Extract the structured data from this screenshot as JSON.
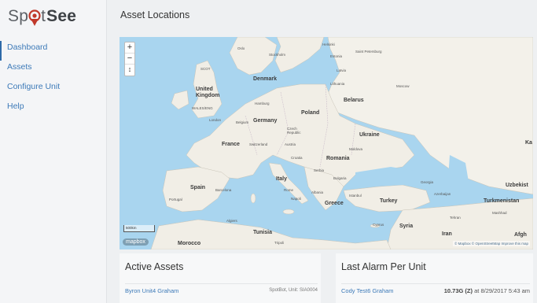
{
  "app": {
    "logo_left": "Sp",
    "logo_mid": "t",
    "logo_right": "See",
    "brand_color": "#c0392b"
  },
  "sidebar": {
    "items": [
      {
        "label": "Dashboard",
        "active": true
      },
      {
        "label": "Assets",
        "active": false
      },
      {
        "label": "Configure Unit",
        "active": false
      },
      {
        "label": "Help",
        "active": false
      }
    ]
  },
  "page": {
    "title": "Asset Locations"
  },
  "map": {
    "zoom_in": "+",
    "zoom_out": "−",
    "reset": "↕",
    "scale": "500km",
    "provider": "mapbox",
    "attribution": "© Mapbox © OpenStreetMap Improve this map",
    "labels": {
      "oslo": "Oslo",
      "stockholm": "Stockholm",
      "helsinki": "Helsinki",
      "saint_petersburg": "Saint Petersburg",
      "estonia": "Estonia",
      "latvia": "Latvia",
      "lithuania": "Lithuania",
      "moscow": "Moscow",
      "scot": "SCOT",
      "united_kingdom": "United Kingdom",
      "wales": "WALES/ENG",
      "london": "London",
      "denmark": "Denmark",
      "hamburg": "Hamburg",
      "poland": "Poland",
      "belarus": "Belarus",
      "germany": "Germany",
      "belgium": "Belgium",
      "czech": "Czech Republic",
      "ukraine": "Ukraine",
      "austria": "Austria",
      "switzerland": "Switzerland",
      "moldova": "Moldova",
      "france": "France",
      "croatia": "Croatia",
      "romania": "Romania",
      "serbia": "Serbia",
      "bulgaria": "Bulgaria",
      "italy": "Italy",
      "spain": "Spain",
      "portugal": "Portugal",
      "barcelona": "Barcelona",
      "rome": "Rome",
      "napoli": "Napoli",
      "albania": "Albania",
      "istanbul": "Istanbul",
      "greece": "Greece",
      "turkey": "Turkey",
      "georgia": "Georgia",
      "azerbaijan": "Azerbaijan",
      "uzbekistan": "Uzbekist",
      "turkmenistan": "Turkmenistan",
      "tehran": "Tehran",
      "mashhad": "Mashhad",
      "iran": "Iran",
      "syria": "Syria",
      "cyprus": "Cyprus",
      "tunisia": "Tunisia",
      "algiers": "Algiers",
      "morocco": "Morocco",
      "tripoli": "Tripoli",
      "kaz": "Ka",
      "afgh": "Afgh"
    }
  },
  "active_assets": {
    "title": "Active Assets",
    "rows": [
      {
        "name": "Byron Unit4 Graham",
        "meta": "SpotBot, Unit: SIA0004"
      }
    ]
  },
  "last_alarm": {
    "title": "Last Alarm Per Unit",
    "rows": [
      {
        "name": "Cody Test6 Graham",
        "value": "10.73G (Z)",
        "time": "at 8/29/2017 5:43 am"
      }
    ]
  }
}
